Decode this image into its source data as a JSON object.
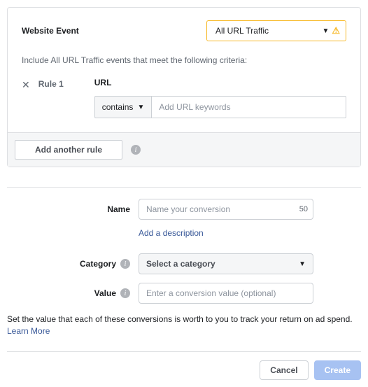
{
  "event": {
    "label": "Website Event",
    "selected": "All URL Traffic"
  },
  "criteria_text": "Include All URL Traffic events that meet the following criteria:",
  "rule": {
    "label": "Rule 1",
    "url_label": "URL",
    "operator": "contains",
    "input_placeholder": "Add URL keywords"
  },
  "add_rule_label": "Add another rule",
  "form": {
    "name": {
      "label": "Name",
      "placeholder": "Name your conversion",
      "char_count": "50"
    },
    "add_description": "Add a description",
    "category": {
      "label": "Category",
      "placeholder": "Select a category"
    },
    "value": {
      "label": "Value",
      "placeholder": "Enter a conversion value (optional)"
    }
  },
  "help_text": "Set the value that each of these conversions is worth to you to track your return on ad spend.",
  "learn_more": "Learn More",
  "buttons": {
    "cancel": "Cancel",
    "create": "Create"
  }
}
